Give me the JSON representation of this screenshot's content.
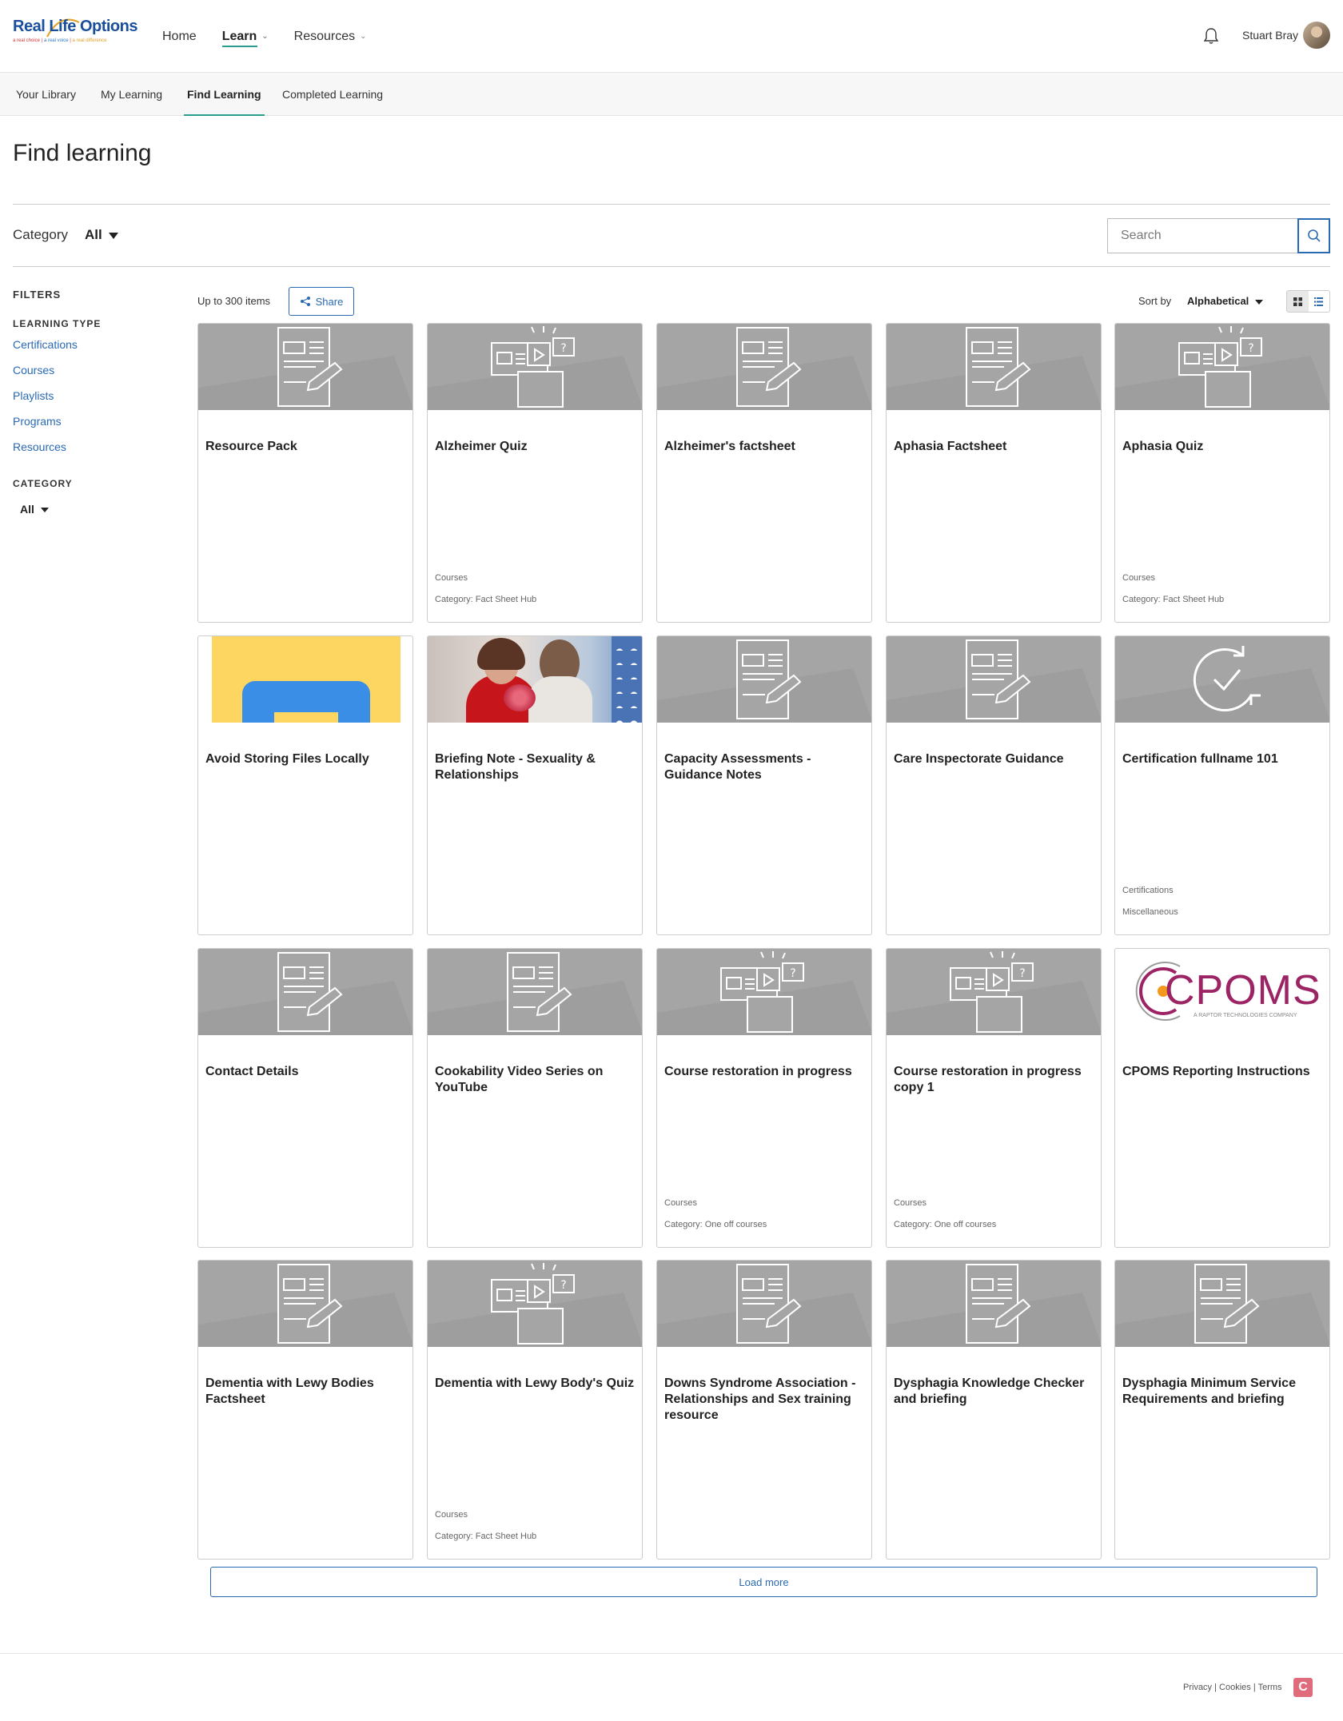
{
  "header": {
    "logo_text_a": "Real",
    "logo_text_b": "Life",
    "logo_text_c": "Options",
    "logo_tag": [
      "a real choice",
      "a real voice",
      "a real difference"
    ],
    "nav": [
      {
        "label": "Home"
      },
      {
        "label": "Learn"
      },
      {
        "label": "Resources"
      }
    ],
    "user_name": "Stuart Bray"
  },
  "subnav": [
    "Your Library",
    "My Learning",
    "Find Learning",
    "Completed Learning"
  ],
  "page_title": "Find learning",
  "category_bar": {
    "label": "Category",
    "value": "All"
  },
  "search": {
    "placeholder": "Search"
  },
  "filters": {
    "title": "FILTERS",
    "learning_type_title": "LEARNING TYPE",
    "learning_types": [
      "Certifications",
      "Courses",
      "Playlists",
      "Programs",
      "Resources"
    ],
    "category_title": "CATEGORY",
    "category_value": "All"
  },
  "toolbar": {
    "count": "Up to 300 items",
    "share": "Share",
    "sort_label": "Sort by",
    "sort_value": "Alphabetical"
  },
  "cards": [
    {
      "title": "Resource Pack",
      "thumb": "doc-icon",
      "meta": []
    },
    {
      "title": "Alzheimer Quiz",
      "thumb": "course-icon",
      "meta": [
        "Courses",
        "Category: Fact Sheet Hub"
      ]
    },
    {
      "title": "Alzheimer's factsheet",
      "thumb": "doc-icon",
      "meta": []
    },
    {
      "title": "Aphasia Factsheet",
      "thumb": "doc-icon",
      "meta": []
    },
    {
      "title": "Aphasia Quiz",
      "thumb": "course-icon",
      "meta": [
        "Courses",
        "Category: Fact Sheet Hub"
      ]
    },
    {
      "title": "Avoid Storing Files Locally",
      "thumb": "yellow-app-image",
      "meta": []
    },
    {
      "title": "Briefing Note - Sexuality & Relationships",
      "thumb": "photo-couple-image",
      "meta": []
    },
    {
      "title": "Capacity Assessments - Guidance Notes",
      "thumb": "doc-icon",
      "meta": []
    },
    {
      "title": "Care Inspectorate Guidance",
      "thumb": "doc-icon",
      "meta": []
    },
    {
      "title": "Certification fullname 101",
      "thumb": "certification-icon",
      "meta": [
        "Certifications",
        "Miscellaneous"
      ]
    },
    {
      "title": "Contact Details",
      "thumb": "doc-icon",
      "meta": []
    },
    {
      "title": "Cookability Video Series on YouTube",
      "thumb": "doc-icon",
      "meta": []
    },
    {
      "title": "Course restoration in progress",
      "thumb": "course-icon",
      "meta": [
        "Courses",
        "Category: One off courses"
      ]
    },
    {
      "title": "Course restoration in progress copy 1",
      "thumb": "course-icon",
      "meta": [
        "Courses",
        "Category: One off courses"
      ]
    },
    {
      "title": "CPOMS Reporting Instructions",
      "thumb": "cpoms-logo",
      "meta": []
    },
    {
      "title": "Dementia with Lewy Bodies Factsheet",
      "thumb": "doc-icon",
      "meta": []
    },
    {
      "title": "Dementia with Lewy Body's Quiz",
      "thumb": "course-icon",
      "meta": [
        "Courses",
        "Category: Fact Sheet Hub"
      ]
    },
    {
      "title": "Downs Syndrome Association - Relationships and Sex training resource",
      "thumb": "doc-icon",
      "meta": []
    },
    {
      "title": "Dysphagia Knowledge Checker and briefing",
      "thumb": "doc-icon",
      "meta": []
    },
    {
      "title": "Dysphagia Minimum Service Requirements and briefing",
      "thumb": "doc-icon",
      "meta": []
    }
  ],
  "cpoms": {
    "logo_text": "CPOMS",
    "logo_sub": "A RAPTOR TECHNOLOGIES COMPANY"
  },
  "load_more": "Load more",
  "footer": {
    "links": [
      "Privacy",
      "Cookies",
      "Terms"
    ],
    "logo_letter": "C"
  },
  "colors": {
    "link": "#2a6ab3",
    "accent": "#2a9d8f",
    "thumb_bg": "#a5a5a5",
    "cpoms": "#9c2465"
  }
}
